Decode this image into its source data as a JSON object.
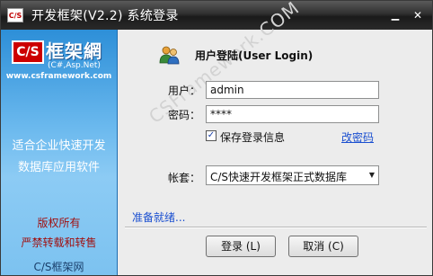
{
  "window": {
    "title": "开发框架(V2.2) 系统登录",
    "app_icon_text": "C/S",
    "minimize_glyph": "▁",
    "close_glyph": "✕"
  },
  "left_panel": {
    "logo_cs": "C/S",
    "logo_text": "框架網",
    "logo_sub": "(C#,Asp.Net)",
    "site": "www.csframework.com",
    "slogan_line1": "适合企业快速开发",
    "slogan_line2": "数据库应用软件",
    "copyright_line1": "版权所有",
    "copyright_line2": "严禁转载和转售",
    "brand": "C/S框架网"
  },
  "form": {
    "title": "用户登陆(User Login)",
    "user_label": "用户：",
    "user_value": "admin",
    "password_label": "密码：",
    "password_value": "****",
    "remember_label": "保存登录信息",
    "remember_checked": true,
    "change_password_link": "改密码",
    "account_label": "帐套：",
    "account_value": "C/S快速开发框架正式数据库",
    "status": "准备就绪...",
    "login_button": "登录 (L)",
    "cancel_button": "取消 (C)",
    "watermark": "CSFramework.COM"
  },
  "icons": {
    "user": "users-icon",
    "dropdown": "chevron-down-icon",
    "checkbox": "checkmark-icon"
  },
  "colors": {
    "titlebar": "#2f2f2f",
    "left_panel": "#6bb9ee",
    "link": "#1a4fd0",
    "copyright": "#a01010"
  }
}
